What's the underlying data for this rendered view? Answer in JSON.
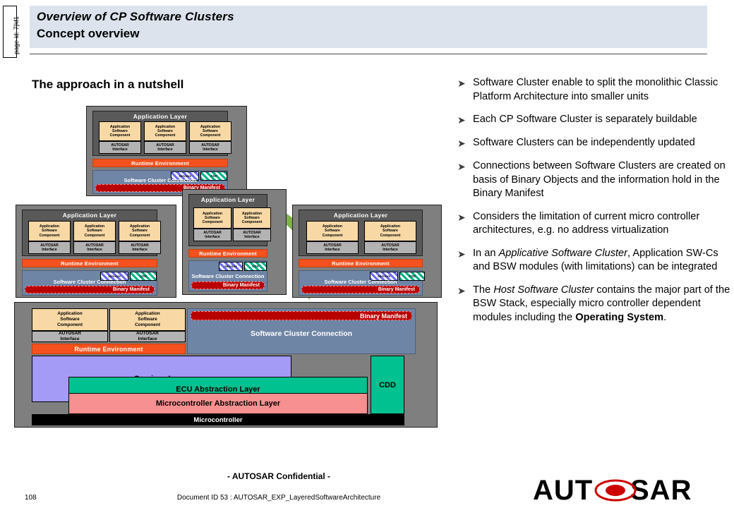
{
  "page": {
    "page_id_label": "page id: 7|kf1",
    "page_number": "108",
    "confidential": "- AUTOSAR  Confidential -",
    "document_id": "Document ID 53 : AUTOSAR_EXP_LayeredSoftwareArchitecture",
    "logo_text": "AUTOSAR"
  },
  "header": {
    "title": "Overview of CP Software Clusters",
    "subtitle": "Concept overview",
    "accent_color": "#dce3ec"
  },
  "section": {
    "heading": "The approach in a nutshell"
  },
  "bullets": [
    {
      "marker": "➤",
      "html": "Software Cluster enable to split the monolithic Classic Platform Architecture into smaller units"
    },
    {
      "marker": "➤",
      "html": "Each CP Software Cluster is separately buildable"
    },
    {
      "marker": "➤",
      "html": "Software Clusters can be independently updated"
    },
    {
      "marker": "➤",
      "html": "Connections between Software Clusters are created on basis of Binary Objects and the information hold in the Binary Manifest"
    },
    {
      "marker": "➤",
      "html": "Considers the limitation of current micro controller architectures, e.g. no address virtualization"
    },
    {
      "marker": "➤",
      "html": "In an <i>Applicative Software Cluster</i>, Application SW-Cs and BSW modules (with limitations) can be integrated"
    },
    {
      "marker": "➤",
      "html": "The <i>Host Software Cluster</i> contains the major part of the BSW Stack, especially micro controller dependent modules including the <b>Operating System</b>."
    }
  ],
  "diagram": {
    "labels": {
      "application_layer": "Application Layer",
      "swc": "Application\nSoftware\nComponent",
      "autosar_interface": "AUTOSAR\nInterface",
      "runtime_environment": "Runtime Environment",
      "software_cluster_connection": "Software Cluster Connection",
      "binary_manifest": "Binary Manifest",
      "applicative_cluster_side": "Applicative  Software  Cluster",
      "host_cluster_side": "Host  Software  Cluster",
      "services_hatch": "Services",
      "cdd_hatch": "CDD",
      "services_layer": "Services Layer",
      "ecu_abstraction_layer": "ECU Abstraction Layer",
      "mcal_layer": "Microcontroller Abstraction Layer",
      "microcontroller": "Microcontroller",
      "cdd": "CDD"
    },
    "clusters": [
      {
        "name": "top-applicative-cluster",
        "swc_count": 3
      },
      {
        "name": "left-applicative-cluster",
        "swc_count": 3
      },
      {
        "name": "middle-applicative-cluster",
        "swc_count": 2
      },
      {
        "name": "right-applicative-cluster",
        "swc_count": 2
      }
    ],
    "colors": {
      "cluster_frame": "#7f7f7f",
      "app_layer": "#595959",
      "swc": "#f8d9a6",
      "interface": "#b3b3b3",
      "rte": "#f4511e",
      "connection": "#6f85a6",
      "binary_manifest": "#b80000",
      "services": "#a39bf5",
      "ecu_abstraction": "#00c18f",
      "mcal": "#f79090",
      "microcontroller": "#000000",
      "arrow": "#7ab648"
    }
  }
}
